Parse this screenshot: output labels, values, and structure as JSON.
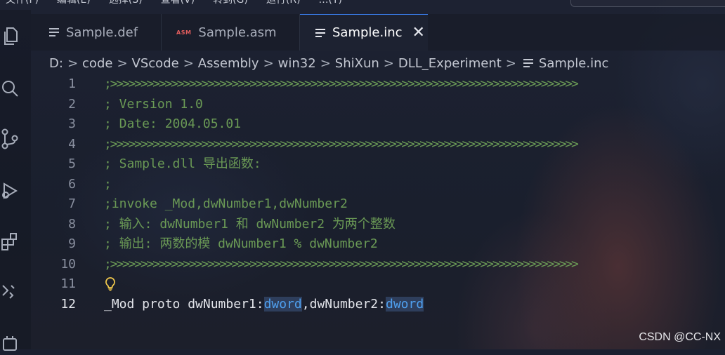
{
  "menu": {
    "items": [
      "文件(F)",
      "编辑(E)",
      "选择(S)",
      "查看(V)",
      "转到(G)",
      "运行(R)",
      "…(T)"
    ]
  },
  "activity_bar": {
    "icons": [
      "explorer-icon",
      "search-icon",
      "source-control-icon",
      "run-debug-icon",
      "extensions-icon",
      "remote-icon",
      "account-icon"
    ]
  },
  "tabs": [
    {
      "label": "Sample.def",
      "icon": "lines-file-icon",
      "active": false
    },
    {
      "label": "Sample.asm",
      "icon": "asm-file-icon",
      "icon_text": "ASM",
      "active": false
    },
    {
      "label": "Sample.inc",
      "icon": "lines-file-icon",
      "active": true,
      "close": "✕"
    }
  ],
  "breadcrumb": {
    "parts": [
      "D:",
      "code",
      "VScode",
      "Assembly",
      "win32",
      "ShiXun",
      "DLL_Experiment"
    ],
    "file": "Sample.inc",
    "separator": ">"
  },
  "editor": {
    "active_line": 12,
    "lines": [
      {
        "n": "1",
        "text": ";>>>>>>>>>>>>>>>>>>>>>>>>>>>>>>>>>>>>>>>>>>>>>>>>>>>>>>>>>>>>>>>>>>>>>>>>>>>>>",
        "kind": "comment"
      },
      {
        "n": "2",
        "text": "; Version 1.0",
        "kind": "comment"
      },
      {
        "n": "3",
        "text": "; Date: 2004.05.01",
        "kind": "comment"
      },
      {
        "n": "4",
        "text": ";>>>>>>>>>>>>>>>>>>>>>>>>>>>>>>>>>>>>>>>>>>>>>>>>>>>>>>>>>>>>>>>>>>>>>>>>>>>>>",
        "kind": "comment"
      },
      {
        "n": "5",
        "text": "; Sample.dll 导出函数:",
        "kind": "comment"
      },
      {
        "n": "6",
        "text": ";",
        "kind": "comment"
      },
      {
        "n": "7",
        "text": ";invoke _Mod,dwNumber1,dwNumber2",
        "kind": "comment"
      },
      {
        "n": "8",
        "text": "; 输入: dwNumber1 和 dwNumber2 为两个整数",
        "kind": "comment"
      },
      {
        "n": "9",
        "text": "; 输出: 两数的模 dwNumber1 % dwNumber2",
        "kind": "comment"
      },
      {
        "n": "10",
        "text": ";>>>>>>>>>>>>>>>>>>>>>>>>>>>>>>>>>>>>>>>>>>>>>>>>>>>>>>>>>>>>>>>>>>>>>>>>>>>>>",
        "kind": "comment"
      },
      {
        "n": "11",
        "text": "",
        "kind": "blank",
        "lightbulb": true
      },
      {
        "n": "12",
        "segments": [
          "_Mod proto dwNumber1:",
          "dword",
          ",dwNumber2:",
          "dword"
        ],
        "kind": "code"
      }
    ]
  },
  "watermark": "CSDN @CC-NX",
  "colors": {
    "comment": "#6a9955",
    "keyword": "#4fa0f0",
    "accent": "#3b82f6"
  }
}
